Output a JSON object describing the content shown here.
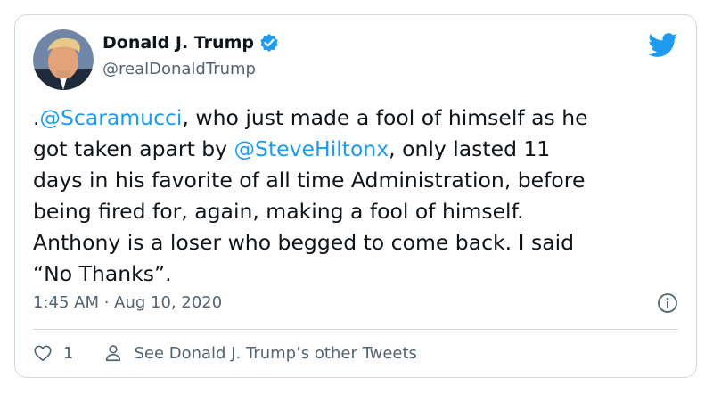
{
  "tweet": {
    "author_name": "Donald J. Trump",
    "author_handle": "@realDonaldTrump",
    "text_parts": {
      "p1": ".",
      "m1": "@Scaramucci",
      "p2": ", who just made a fool of himself as he\ngot taken apart by ",
      "m2": "@SteveHiltonx",
      "p3": ", only lasted 11\ndays in his favorite of all time Administration, before\nbeing fired for, again, making a fool of himself.\nAnthony is a loser who begged to come back. I said\n“No Thanks”."
    },
    "timestamp": "1:45 AM · Aug 10, 2020",
    "like_count": "1",
    "other_tweets_label": "See Donald J. Trump’s other Tweets"
  },
  "colors": {
    "accent": "#1d9bf0",
    "text": "#0f1419",
    "secondary": "#536471",
    "border": "#cfd9de"
  },
  "icons": {
    "verified": "verified-badge-icon",
    "brand": "twitter-bird-icon",
    "info": "info-icon",
    "like": "heart-icon",
    "profile": "person-icon"
  }
}
